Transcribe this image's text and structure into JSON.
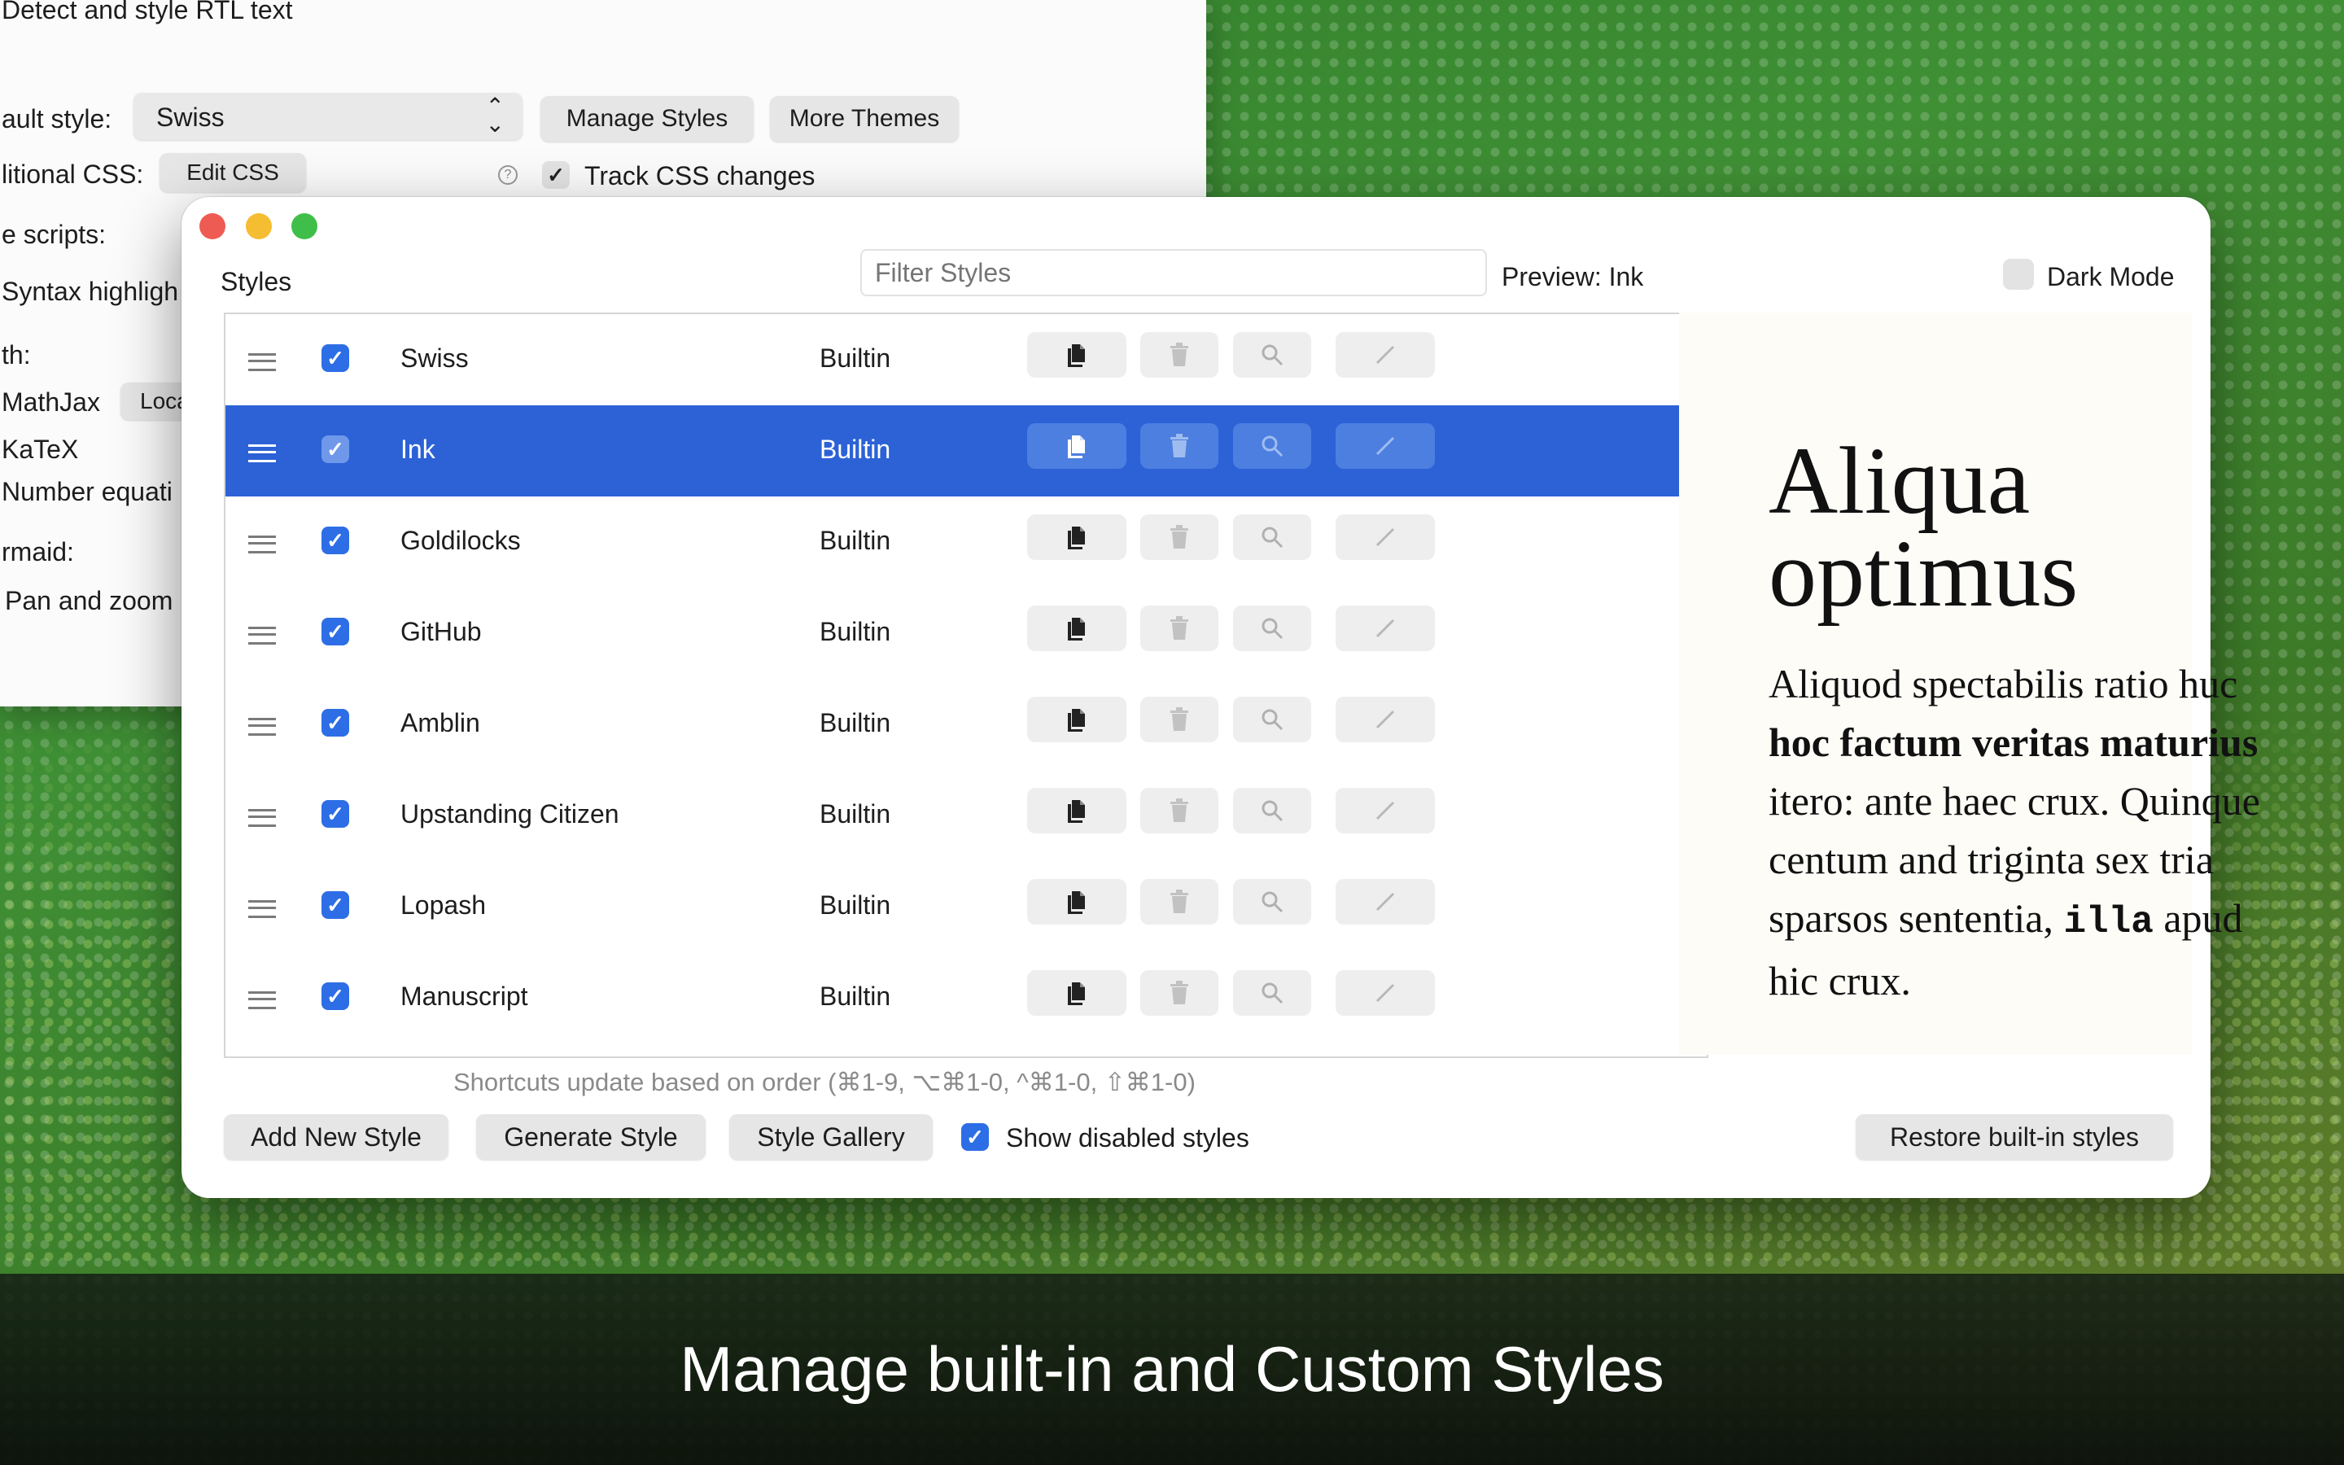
{
  "caption": "Manage built-in and Custom Styles",
  "settings": {
    "rtl_label": "Detect and style RTL text",
    "default_style_label": "ault style:",
    "default_style_value": "Swiss",
    "manage_styles": "Manage Styles",
    "more_themes": "More Themes",
    "additional_css_label": "litional CSS:",
    "edit_css": "Edit CSS",
    "help_glyph": "?",
    "track_css": "Track CSS changes",
    "scripts_label": "e scripts:",
    "syntax_label": "Syntax highligh",
    "math_label": "th:",
    "mathjax": "MathJax",
    "mathjax_mode": "Loca",
    "katex": "KaTeX",
    "number_equations": "Number equati",
    "mermaid_label": "rmaid:",
    "pan_zoom": "Pan and zoom"
  },
  "dialog": {
    "styles_label": "Styles",
    "filter_placeholder": "Filter Styles",
    "preview_label": "Preview: Ink",
    "dark_mode": "Dark Mode",
    "shortcuts_hint": "Shortcuts update based on order (⌘1-9, ⌥⌘1-0, ^⌘1-0, ⇧⌘1-0)",
    "add_new_style": "Add New Style",
    "generate_style": "Generate Style",
    "style_gallery": "Style Gallery",
    "show_disabled": "Show disabled styles",
    "restore_builtin": "Restore built-in styles",
    "rows": [
      {
        "name": "Swiss",
        "kind": "Builtin"
      },
      {
        "name": "Ink",
        "kind": "Builtin"
      },
      {
        "name": "Goldilocks",
        "kind": "Builtin"
      },
      {
        "name": "GitHub",
        "kind": "Builtin"
      },
      {
        "name": "Amblin",
        "kind": "Builtin"
      },
      {
        "name": "Upstanding Citizen",
        "kind": "Builtin"
      },
      {
        "name": "Lopash",
        "kind": "Builtin"
      },
      {
        "name": "Manuscript",
        "kind": "Builtin"
      }
    ],
    "selected_row": "Ink",
    "preview": {
      "heading": "Aliqua optimus",
      "p_a": "Aliquod spectabilis ratio huc ",
      "p_bold": "hoc factum veritas maturius",
      "p_b": " itero: ante haec crux. Quinque centum and triginta sex tria sparsos sententia, ",
      "p_code": "illa",
      "p_c": " apud hic crux."
    }
  },
  "colors": {
    "accent": "#2c62d6",
    "checkbox": "#2d6ee6",
    "close": "#ee5b52",
    "minimize": "#f5bd31",
    "zoom": "#3fbf49"
  }
}
